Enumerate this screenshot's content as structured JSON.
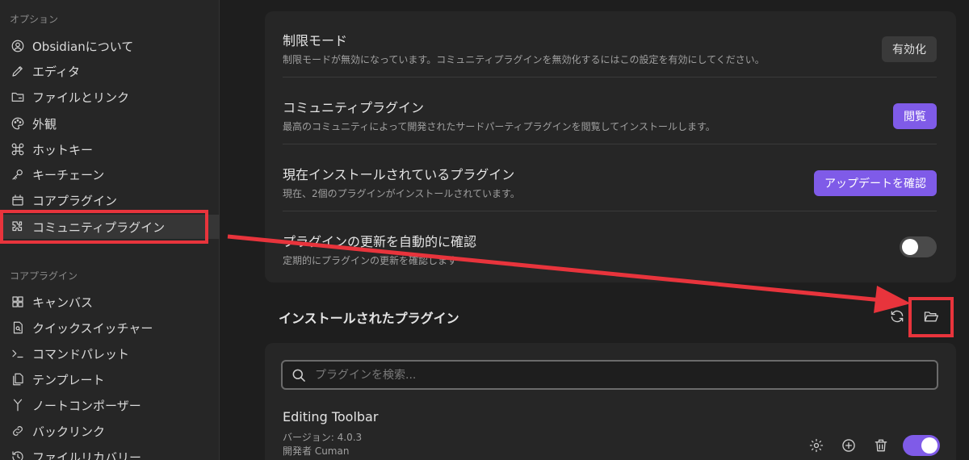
{
  "sidebar": {
    "section1": "オプション",
    "options": [
      {
        "label": "Obsidianについて",
        "icon": "user-circle-icon"
      },
      {
        "label": "エディタ",
        "icon": "pencil-icon"
      },
      {
        "label": "ファイルとリンク",
        "icon": "folder-link-icon"
      },
      {
        "label": "外観",
        "icon": "palette-icon"
      },
      {
        "label": "ホットキー",
        "icon": "command-icon"
      },
      {
        "label": "キーチェーン",
        "icon": "key-icon"
      },
      {
        "label": "コアプラグイン",
        "icon": "calendar-box-icon"
      },
      {
        "label": "コミュニティプラグイン",
        "icon": "puzzle-icon"
      }
    ],
    "section2": "コアプラグイン",
    "core": [
      {
        "label": "キャンバス",
        "icon": "grid-icon"
      },
      {
        "label": "クイックスイッチャー",
        "icon": "file-search-icon"
      },
      {
        "label": "コマンドパレット",
        "icon": "terminal-icon"
      },
      {
        "label": "テンプレート",
        "icon": "files-icon"
      },
      {
        "label": "ノートコンポーザー",
        "icon": "merge-icon"
      },
      {
        "label": "バックリンク",
        "icon": "link-icon"
      },
      {
        "label": "ファイルリカバリー",
        "icon": "history-icon"
      }
    ]
  },
  "settings": [
    {
      "name": "制限モード",
      "desc": "制限モードが無効になっています。コミュニティプラグインを無効化するにはこの設定を有効にしてください。",
      "button": "有効化"
    },
    {
      "name": "コミュニティプラグイン",
      "desc": "最高のコミュニティによって開発されたサードパーティプラグインを閲覧してインストールします。",
      "button": "閲覧"
    },
    {
      "name": "現在インストールされているプラグイン",
      "desc": "現在、2個のプラグインがインストールされています。",
      "button": "アップデートを確認"
    },
    {
      "name": "プラグインの更新を自動的に確認",
      "desc": "定期的にプラグインの更新を確認します"
    }
  ],
  "installed": {
    "title": "インストールされたプラグイン",
    "search_placeholder": "プラグインを検索...",
    "plugin": {
      "name": "Editing Toolbar",
      "version": "バージョン: 4.0.3",
      "author": "開発者 Cuman"
    }
  },
  "colors": {
    "accent": "#7f5be8",
    "highlight": "#e8343c"
  }
}
